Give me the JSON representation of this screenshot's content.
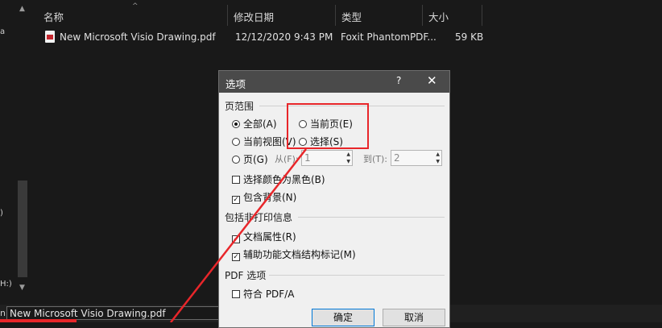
{
  "left_nav": {
    "fragments": [
      "a",
      ")",
      "H:)"
    ]
  },
  "file_list": {
    "columns": [
      "名称",
      "修改日期",
      "类型",
      "大小"
    ],
    "rows": [
      {
        "name": "New Microsoft Visio Drawing.pdf",
        "modified": "12/12/2020 9:43 PM",
        "type": "Foxit PhantomPDF...",
        "size": "59 KB"
      }
    ]
  },
  "filename_bar": {
    "label": "n:",
    "value": "New Microsoft Visio Drawing.pdf"
  },
  "dialog": {
    "title": "选项",
    "help_label": "?",
    "close_label": "✕",
    "page_range": {
      "heading": "页范围",
      "all": "全部(A)",
      "current_page": "当前页(E)",
      "current_view": "当前视图(V)",
      "selection": "选择(S)",
      "pages": "页(G)",
      "from_label": "从(F):",
      "from_value": "1",
      "to_label": "到(T):",
      "to_value": "2",
      "selected": "all"
    },
    "color_option": "选择颜色为黑色(B)",
    "color_checked": false,
    "background_option": "包含背景(N)",
    "background_checked": true,
    "non_print": {
      "heading": "包括非打印信息",
      "doc_props": "文档属性(R)",
      "doc_props_checked": true,
      "accessibility": "辅助功能文档结构标记(M)",
      "accessibility_checked": true
    },
    "pdf_options": {
      "heading": "PDF 选项",
      "pdfa": "符合 PDF/A",
      "pdfa_checked": false
    },
    "ok_label": "确定",
    "cancel_label": "取消"
  },
  "colors": {
    "annotation_red": "#e8262a",
    "dialog_title_bg": "#4a4a4a",
    "explorer_bg": "#191919"
  }
}
